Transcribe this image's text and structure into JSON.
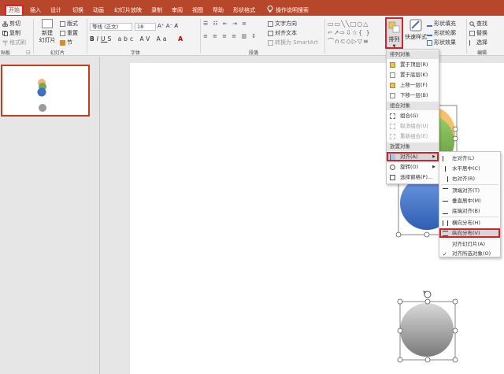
{
  "tabs": [
    {
      "label": "开始",
      "active": true
    },
    {
      "label": "插入"
    },
    {
      "label": "设计"
    },
    {
      "label": "切换"
    },
    {
      "label": "动画"
    },
    {
      "label": "幻灯片放映"
    },
    {
      "label": "录制"
    },
    {
      "label": "审阅"
    },
    {
      "label": "视图"
    },
    {
      "label": "帮助"
    },
    {
      "label": "形状格式"
    },
    {
      "label": "操作说明搜索"
    }
  ],
  "clipboard": {
    "cut": "剪切",
    "copy": "复制",
    "format_painter": "格式刷",
    "group": "贴板"
  },
  "slides": {
    "new_slide_1": "新建",
    "new_slide_2": "幻灯片",
    "layout": "版式",
    "reset": "重置",
    "section": "节",
    "group": "幻灯片"
  },
  "font": {
    "name": "等线 (正文)",
    "size": "18",
    "group": "字体"
  },
  "paragraph": {
    "text_direction": "文字方向",
    "align_text": "对齐文本",
    "smartart": "转换为 SmartArt",
    "group": "段落"
  },
  "drawing": {
    "arrange": "排列",
    "quick_styles": "快速样式",
    "fill": "形状填充",
    "outline": "形状轮廓",
    "effects": "形状效果"
  },
  "editing": {
    "find": "查找",
    "replace": "替换",
    "select": "选择",
    "group": "编辑"
  },
  "arrange_menu": {
    "header_order": "排列对象",
    "bring_front": "置于顶层(R)",
    "send_back": "置于底层(K)",
    "bring_forward": "上移一层(F)",
    "send_backward": "下移一层(B)",
    "header_group": "组合对象",
    "group": "组合(G)",
    "ungroup": "取消组合(U)",
    "regroup": "重新组合(E)",
    "header_position": "放置对象",
    "align": "对齐(A)",
    "rotate": "旋转(O)",
    "selection_pane": "选择窗格(P)..."
  },
  "align_menu": {
    "left": "左对齐(L)",
    "center": "水平居中(C)",
    "right": "右对齐(R)",
    "top": "顶端对齐(T)",
    "middle": "垂直居中(M)",
    "bottom": "底端对齐(B)",
    "distribute_h": "横向分布(H)",
    "distribute_v": "纵向分布(V)",
    "to_slide": "对齐幻灯片(A)",
    "to_selected": "对齐所选对象(O)"
  },
  "colors": {
    "accent": "#b7472a",
    "highlight": "#d2232a",
    "blue": "#3e6fc4",
    "green": "#70ad47",
    "orange": "#f4b183",
    "gray": "#8c8c8c"
  }
}
